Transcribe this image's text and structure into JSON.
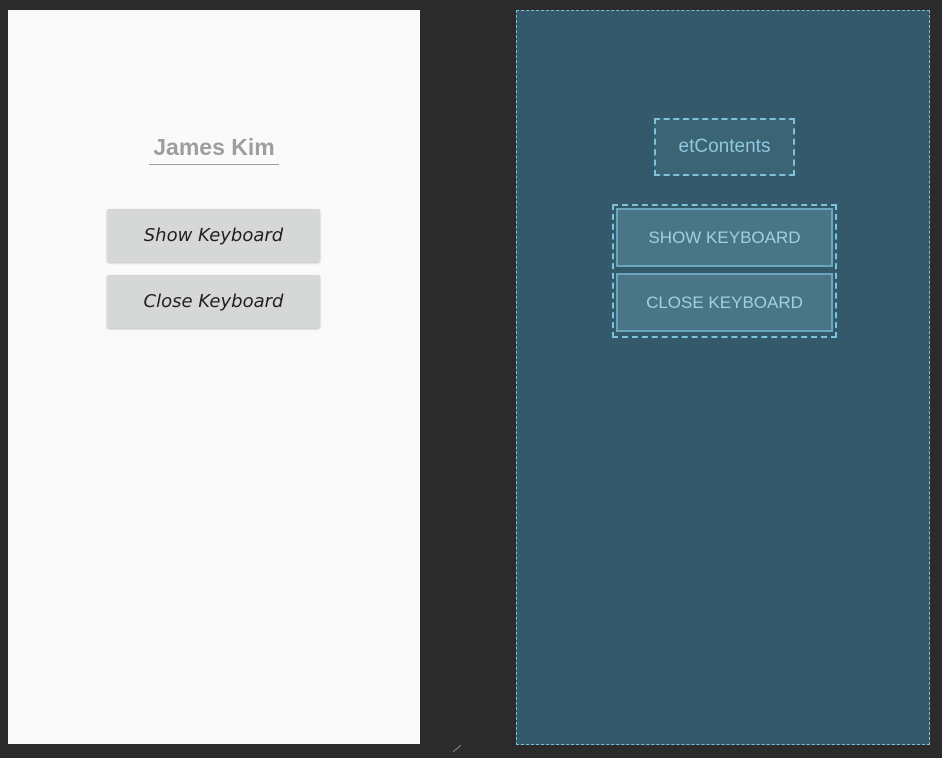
{
  "design_preview": {
    "edit_text_value": "James Kim",
    "show_keyboard_label": "Show Keyboard",
    "close_keyboard_label": "Close Keyboard"
  },
  "blueprint": {
    "edit_text_id": "etContents",
    "show_keyboard_label": "SHOW KEYBOARD",
    "close_keyboard_label": "CLOSE KEYBOARD"
  },
  "colors": {
    "canvas_background": "#2b2b2b",
    "design_background": "#fafafa",
    "button_background": "#d6d7d7",
    "blueprint_background": "#33596b",
    "blueprint_outline": "#7fc2dc"
  }
}
